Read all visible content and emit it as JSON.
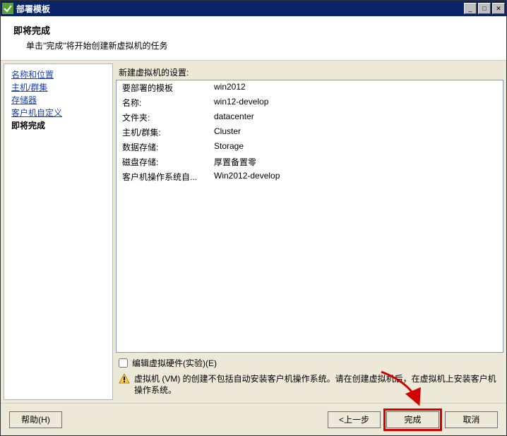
{
  "window": {
    "title": "部署模板"
  },
  "header": {
    "title": "即将完成",
    "subtitle": "单击\"完成\"将开始创建新虚拟机的任务"
  },
  "sidebar": {
    "items": [
      {
        "label": "名称和位置",
        "link": true
      },
      {
        "label": "主机/群集",
        "link": true
      },
      {
        "label": "存储器",
        "link": true
      },
      {
        "label": "客户机自定义",
        "link": true
      },
      {
        "label": "即将完成",
        "link": false
      }
    ]
  },
  "content": {
    "settings_label": "新建虚拟机的设置:",
    "rows": [
      {
        "k": "要部署的模板",
        "v": "win2012"
      },
      {
        "k": "名称:",
        "v": "win12-develop"
      },
      {
        "k": "文件夹:",
        "v": "datacenter"
      },
      {
        "k": "主机/群集:",
        "v": "Cluster"
      },
      {
        "k": "数据存储:",
        "v": "Storage"
      },
      {
        "k": "磁盘存储:",
        "v": "厚置备置零"
      },
      {
        "k": "客户机操作系统自...",
        "v": "Win2012-develop"
      }
    ],
    "edit_hw_label": "编辑虚拟硬件(实验)(E)",
    "warning": "虚拟机 (VM) 的创建不包括自动安装客户机操作系统。请在创建虚拟机后，在虚拟机上安装客户机操作系统。"
  },
  "footer": {
    "help": "帮助(H)",
    "back": "<上一步",
    "finish": "完成",
    "cancel": "取消"
  }
}
